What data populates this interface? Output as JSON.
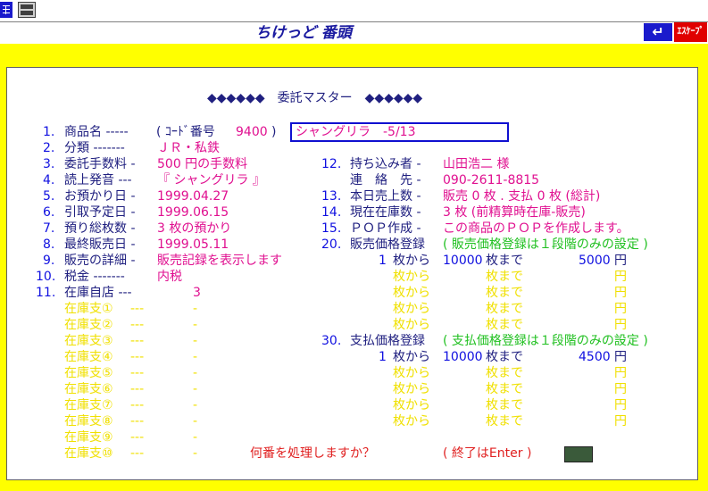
{
  "app_title": "ちけっど 番頭",
  "buttons": {
    "back_symbol": "↵",
    "escape_label": "ｴｽｹｰﾌﾟ"
  },
  "header": {
    "title": "◆◆◆◆◆◆　委託マスター　◆◆◆◆◆◆"
  },
  "fields": {
    "f1_num": "1.",
    "f1_label": "商品名 -----",
    "f1_code": "( ｺｰﾄﾞ番号",
    "f1_code_value": "9400",
    "f1_close": ")",
    "f1_value": "シャングリラ　-5/13",
    "f2_num": "2.",
    "f2_label": "分類 -------",
    "f2_value": "ＪＲ・私鉄",
    "f3_num": "3.",
    "f3_label": "委託手数料 -",
    "f3_value": "500 円の手数料",
    "f4_num": "4.",
    "f4_label": "読上発音 ---",
    "f4_value": "『 シャングリラ 』",
    "f5_num": "5.",
    "f5_label": "お預かり日 -",
    "f5_value": "1999.04.27",
    "f6_num": "6.",
    "f6_label": "引取予定日 -",
    "f6_value": "1999.06.15",
    "f7_num": "7.",
    "f7_label": "預り総枚数 -",
    "f7_value": "3 枚の預かり",
    "f8_num": "8.",
    "f8_label": "最終販売日 -",
    "f8_value": "1999.05.11",
    "f9_num": "9.",
    "f9_label": "販売の詳細 -",
    "f9_value": "販売記録を表示します",
    "f10_num": "10.",
    "f10_label": "税金 -------",
    "f10_value": "内税",
    "f11_num": "11.",
    "f11_label": "在庫自店 ---",
    "f11_value": "3",
    "f12_num": "12.",
    "f12_label": "持ち込み者 -",
    "f12_value": "山田浩二 様",
    "contact_label": "連　絡　先 -",
    "contact_value": "090-2611-8815",
    "f13_num": "13.",
    "f13_label": "本日売上数 -",
    "f13_value": "販売 0 枚 . 支払 0 枚 (総計)",
    "f14_num": "14.",
    "f14_label": "現在在庫数 -",
    "f14_value": "3 枚 (前精算時在庫-販売)",
    "f15_num": "15.",
    "f15_label": "ＰＯＰ作成 -",
    "f15_value": "この商品のＰＯＰを作成します。",
    "f20_num": "20.",
    "f20_label": "販売価格登録",
    "f20_note": "( 販売価格登録は１段階のみの設定 )",
    "f30_num": "30.",
    "f30_label": "支払価格登録",
    "f30_note": "( 支払価格登録は１段階のみの設定 )"
  },
  "branches": [
    {
      "label": "在庫支①",
      "dash": "---",
      "value": "-"
    },
    {
      "label": "在庫支②",
      "dash": "---",
      "value": "-"
    },
    {
      "label": "在庫支③",
      "dash": "---",
      "value": "-"
    },
    {
      "label": "在庫支④",
      "dash": "---",
      "value": "-"
    },
    {
      "label": "在庫支⑤",
      "dash": "---",
      "value": "-"
    },
    {
      "label": "在庫支⑥",
      "dash": "---",
      "value": "-"
    },
    {
      "label": "在庫支⑦",
      "dash": "---",
      "value": "-"
    },
    {
      "label": "在庫支⑧",
      "dash": "---",
      "value": "-"
    },
    {
      "label": "在庫支⑨",
      "dash": "---",
      "value": "-"
    },
    {
      "label": "在庫支⑩",
      "dash": "---",
      "value": "-"
    }
  ],
  "sale_prices": [
    {
      "from": "1",
      "from_unit": "枚から",
      "to": "10000",
      "to_unit": "枚まで",
      "price": "5000",
      "yen": "円"
    },
    {
      "from": "",
      "from_unit": "枚から",
      "to": "",
      "to_unit": "枚まで",
      "price": "",
      "yen": "円"
    },
    {
      "from": "",
      "from_unit": "枚から",
      "to": "",
      "to_unit": "枚まで",
      "price": "",
      "yen": "円"
    },
    {
      "from": "",
      "from_unit": "枚から",
      "to": "",
      "to_unit": "枚まで",
      "price": "",
      "yen": "円"
    }
  ],
  "pay_prices": [
    {
      "from": "1",
      "from_unit": "枚から",
      "to": "10000",
      "to_unit": "枚まで",
      "price": "4500",
      "yen": "円"
    },
    {
      "from": "",
      "from_unit": "枚から",
      "to": "",
      "to_unit": "枚まで",
      "price": "",
      "yen": "円"
    },
    {
      "from": "",
      "from_unit": "枚から",
      "to": "",
      "to_unit": "枚まで",
      "price": "",
      "yen": "円"
    },
    {
      "from": "",
      "from_unit": "枚から",
      "to": "",
      "to_unit": "枚まで",
      "price": "",
      "yen": "円"
    },
    {
      "from": "",
      "from_unit": "枚から",
      "to": "",
      "to_unit": "枚まで",
      "price": "",
      "yen": "円"
    }
  ],
  "prompt": {
    "question": "何番を処理しますか？",
    "hint": "( 終了はEnter )"
  },
  "colors": {
    "background": "#ffff00",
    "label": "#202080",
    "value": "#e01090",
    "note": "#20c020",
    "empty": "#f0e000"
  }
}
